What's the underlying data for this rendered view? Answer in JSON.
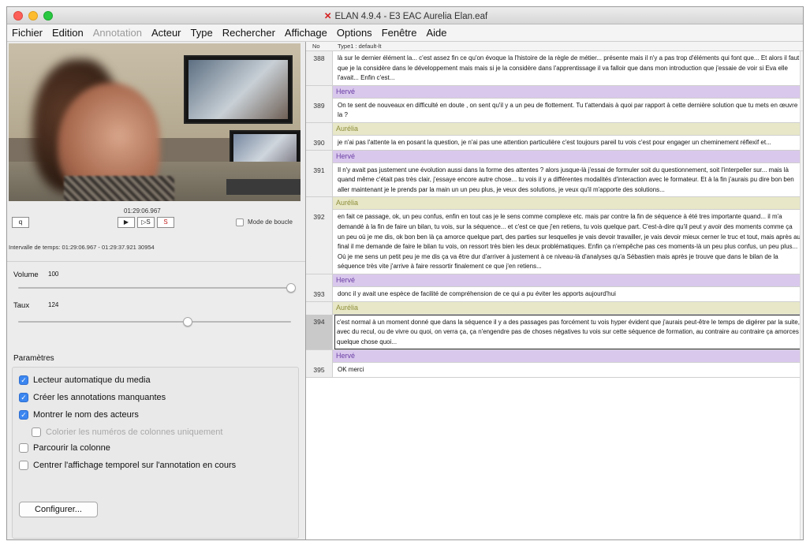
{
  "window": {
    "title": "ELAN 4.9.4 - E3 EAC Aurelia Elan.eaf"
  },
  "menu": [
    "Fichier",
    "Edition",
    "Annotation",
    "Acteur",
    "Type",
    "Rechercher",
    "Affichage",
    "Options",
    "Fenêtre",
    "Aide"
  ],
  "menu_disabled": [
    "Annotation"
  ],
  "player": {
    "timecode": "01:29:06.967",
    "small_button": "q",
    "buttons": [
      "▶",
      "▷S",
      "S"
    ],
    "loop_label": "Mode de boucle",
    "interval": "Intervalle de temps: 01:29:06.967 - 01:29:37.921  30954"
  },
  "volume": {
    "label": "Volume",
    "value": "100",
    "level": 1.0
  },
  "rate": {
    "label": "Taux",
    "value": "124",
    "level": 0.62
  },
  "params": {
    "title": "Paramètres",
    "options": [
      {
        "label": "Lecteur automatique du media",
        "checked": true
      },
      {
        "label": "Créer les annotations manquantes",
        "checked": true
      },
      {
        "label": "Montrer le nom des acteurs",
        "checked": true
      },
      {
        "label": "Colorier les numéros de colonnes uniquement",
        "checked": false,
        "dim": true
      },
      {
        "label": "Parcourir la colonne",
        "checked": false
      },
      {
        "label": "Centrer l'affichage temporel sur l'annotation en cours",
        "checked": false
      }
    ],
    "configure": "Configurer..."
  },
  "table": {
    "col_no": "No",
    "col_type": "Type1 : default-lt",
    "rows": [
      {
        "kind": "row",
        "num": "388",
        "text": "là sur le dernier élément la... c'est assez fin ce qu'on évoque la l'histoire de la règle de métier... présente mais il n'y a pas trop d'éléments qui font que... Et alors il faut que je la considère dans le développement mais mais si je la considère dans l'apprentissage il va falloir que dans mon introduction que j'essaie de voir si Eva elle l'avait... Enfin c'est..."
      },
      {
        "kind": "speaker",
        "speaker": "Hervé",
        "style": "herve"
      },
      {
        "kind": "row",
        "num": "389",
        "text": "On te sent de nouveaux en difficulté en doute , on sent qu'il y a un peu de flottement.  Tu t'attendais à quoi  par rapport  à cette dernière solution que tu mets en œuvre la ?"
      },
      {
        "kind": "speaker",
        "speaker": "Aurélia",
        "style": "aurelia"
      },
      {
        "kind": "row",
        "num": "390",
        "text": "je n'ai pas l'attente la en posant la question, je n'ai pas une attention particulière c'est toujours pareil tu vois c'est pour engager un cheminement réflexif et..."
      },
      {
        "kind": "speaker",
        "speaker": "Hervé",
        "style": "herve"
      },
      {
        "kind": "row",
        "num": "391",
        "text": "Il n'y avait pas justement une évolution aussi dans la forme des attentes ? alors jusque-là j'essai de formuler soit du questionnement, soit l'interpeller sur... mais là quand même c'était pas très clair, j'essaye encore autre chose... tu vois il y a différentes modalités d'interaction avec le formateur. Et à la fin j'aurais pu dire bon ben aller maintenant je le prends par la main un un peu plus, je veux des solutions,  je veux qu'il m'apporte des solutions..."
      },
      {
        "kind": "speaker",
        "speaker": "Aurélia",
        "style": "aurelia"
      },
      {
        "kind": "row",
        "num": "392",
        "text": "en fait ce passage, ok,  un peu confus, enfin en tout cas je le sens comme complexe etc. mais par contre la fin de séquence à été tres importante quand... il m'a demandé à la fin de faire un bilan, tu vois, sur la séquence... et c'est ce que j'en retiens, tu vois quelque part. C'est-à-dire qu'il peut y avoir des moments  comme ça un peu où je me dis, ok bon ben là ça amorce quelque part, des parties sur lesquelles je vais devoir travailler, je vais devoir mieux cerner le truc et tout, mais après au final il me demande de faire le bilan tu vois, on ressort très bien les deux problématiques.  Enfin ça n'empêche pas ces moments-là un peu plus confus, un peu plus... Où je me sens un petit peu je me dis ça va être dur d'arriver à justement à ce niveau-là d'analyses qu'a Sébastien mais après je trouve que dans le bilan de la séquence très vite j'arrive à faire ressortir finalement ce que j'en retiens..."
      },
      {
        "kind": "speaker",
        "speaker": "Hervé",
        "style": "herve"
      },
      {
        "kind": "row",
        "num": "393",
        "text": "donc il y avait une espèce de facilité de compréhension de ce qui a pu éviter les apports aujourd'hui"
      },
      {
        "kind": "speaker",
        "speaker": "Aurélia",
        "style": "aurelia"
      },
      {
        "kind": "row",
        "num": "394",
        "selected": true,
        "text": "c'est normal à un moment donné que dans la séquence il y a des passages pas forcément tu vois hyper évident que j'aurais peut-être le temps de digérer par la suite,  avec du recul, ou de vivre ou quoi, on verra ça, ça n'engendre pas de choses négatives tu vois sur cette séquence de formation, au contraire au contraire ça amorces quelque chose quoi..."
      },
      {
        "kind": "speaker",
        "speaker": "Hervé",
        "style": "herve"
      },
      {
        "kind": "row",
        "num": "395",
        "text": "OK merci"
      }
    ]
  }
}
